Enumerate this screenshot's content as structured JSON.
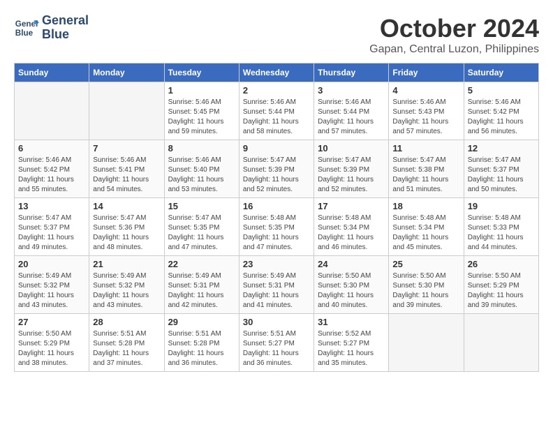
{
  "logo": {
    "line1": "General",
    "line2": "Blue"
  },
  "title": {
    "month_year": "October 2024",
    "location": "Gapan, Central Luzon, Philippines"
  },
  "days_of_week": [
    "Sunday",
    "Monday",
    "Tuesday",
    "Wednesday",
    "Thursday",
    "Friday",
    "Saturday"
  ],
  "weeks": [
    [
      {
        "day": "",
        "sunrise": "",
        "sunset": "",
        "daylight": ""
      },
      {
        "day": "",
        "sunrise": "",
        "sunset": "",
        "daylight": ""
      },
      {
        "day": "1",
        "sunrise": "Sunrise: 5:46 AM",
        "sunset": "Sunset: 5:45 PM",
        "daylight": "Daylight: 11 hours and 59 minutes."
      },
      {
        "day": "2",
        "sunrise": "Sunrise: 5:46 AM",
        "sunset": "Sunset: 5:44 PM",
        "daylight": "Daylight: 11 hours and 58 minutes."
      },
      {
        "day": "3",
        "sunrise": "Sunrise: 5:46 AM",
        "sunset": "Sunset: 5:44 PM",
        "daylight": "Daylight: 11 hours and 57 minutes."
      },
      {
        "day": "4",
        "sunrise": "Sunrise: 5:46 AM",
        "sunset": "Sunset: 5:43 PM",
        "daylight": "Daylight: 11 hours and 57 minutes."
      },
      {
        "day": "5",
        "sunrise": "Sunrise: 5:46 AM",
        "sunset": "Sunset: 5:42 PM",
        "daylight": "Daylight: 11 hours and 56 minutes."
      }
    ],
    [
      {
        "day": "6",
        "sunrise": "Sunrise: 5:46 AM",
        "sunset": "Sunset: 5:42 PM",
        "daylight": "Daylight: 11 hours and 55 minutes."
      },
      {
        "day": "7",
        "sunrise": "Sunrise: 5:46 AM",
        "sunset": "Sunset: 5:41 PM",
        "daylight": "Daylight: 11 hours and 54 minutes."
      },
      {
        "day": "8",
        "sunrise": "Sunrise: 5:46 AM",
        "sunset": "Sunset: 5:40 PM",
        "daylight": "Daylight: 11 hours and 53 minutes."
      },
      {
        "day": "9",
        "sunrise": "Sunrise: 5:47 AM",
        "sunset": "Sunset: 5:39 PM",
        "daylight": "Daylight: 11 hours and 52 minutes."
      },
      {
        "day": "10",
        "sunrise": "Sunrise: 5:47 AM",
        "sunset": "Sunset: 5:39 PM",
        "daylight": "Daylight: 11 hours and 52 minutes."
      },
      {
        "day": "11",
        "sunrise": "Sunrise: 5:47 AM",
        "sunset": "Sunset: 5:38 PM",
        "daylight": "Daylight: 11 hours and 51 minutes."
      },
      {
        "day": "12",
        "sunrise": "Sunrise: 5:47 AM",
        "sunset": "Sunset: 5:37 PM",
        "daylight": "Daylight: 11 hours and 50 minutes."
      }
    ],
    [
      {
        "day": "13",
        "sunrise": "Sunrise: 5:47 AM",
        "sunset": "Sunset: 5:37 PM",
        "daylight": "Daylight: 11 hours and 49 minutes."
      },
      {
        "day": "14",
        "sunrise": "Sunrise: 5:47 AM",
        "sunset": "Sunset: 5:36 PM",
        "daylight": "Daylight: 11 hours and 48 minutes."
      },
      {
        "day": "15",
        "sunrise": "Sunrise: 5:47 AM",
        "sunset": "Sunset: 5:35 PM",
        "daylight": "Daylight: 11 hours and 47 minutes."
      },
      {
        "day": "16",
        "sunrise": "Sunrise: 5:48 AM",
        "sunset": "Sunset: 5:35 PM",
        "daylight": "Daylight: 11 hours and 47 minutes."
      },
      {
        "day": "17",
        "sunrise": "Sunrise: 5:48 AM",
        "sunset": "Sunset: 5:34 PM",
        "daylight": "Daylight: 11 hours and 46 minutes."
      },
      {
        "day": "18",
        "sunrise": "Sunrise: 5:48 AM",
        "sunset": "Sunset: 5:34 PM",
        "daylight": "Daylight: 11 hours and 45 minutes."
      },
      {
        "day": "19",
        "sunrise": "Sunrise: 5:48 AM",
        "sunset": "Sunset: 5:33 PM",
        "daylight": "Daylight: 11 hours and 44 minutes."
      }
    ],
    [
      {
        "day": "20",
        "sunrise": "Sunrise: 5:49 AM",
        "sunset": "Sunset: 5:32 PM",
        "daylight": "Daylight: 11 hours and 43 minutes."
      },
      {
        "day": "21",
        "sunrise": "Sunrise: 5:49 AM",
        "sunset": "Sunset: 5:32 PM",
        "daylight": "Daylight: 11 hours and 43 minutes."
      },
      {
        "day": "22",
        "sunrise": "Sunrise: 5:49 AM",
        "sunset": "Sunset: 5:31 PM",
        "daylight": "Daylight: 11 hours and 42 minutes."
      },
      {
        "day": "23",
        "sunrise": "Sunrise: 5:49 AM",
        "sunset": "Sunset: 5:31 PM",
        "daylight": "Daylight: 11 hours and 41 minutes."
      },
      {
        "day": "24",
        "sunrise": "Sunrise: 5:50 AM",
        "sunset": "Sunset: 5:30 PM",
        "daylight": "Daylight: 11 hours and 40 minutes."
      },
      {
        "day": "25",
        "sunrise": "Sunrise: 5:50 AM",
        "sunset": "Sunset: 5:30 PM",
        "daylight": "Daylight: 11 hours and 39 minutes."
      },
      {
        "day": "26",
        "sunrise": "Sunrise: 5:50 AM",
        "sunset": "Sunset: 5:29 PM",
        "daylight": "Daylight: 11 hours and 39 minutes."
      }
    ],
    [
      {
        "day": "27",
        "sunrise": "Sunrise: 5:50 AM",
        "sunset": "Sunset: 5:29 PM",
        "daylight": "Daylight: 11 hours and 38 minutes."
      },
      {
        "day": "28",
        "sunrise": "Sunrise: 5:51 AM",
        "sunset": "Sunset: 5:28 PM",
        "daylight": "Daylight: 11 hours and 37 minutes."
      },
      {
        "day": "29",
        "sunrise": "Sunrise: 5:51 AM",
        "sunset": "Sunset: 5:28 PM",
        "daylight": "Daylight: 11 hours and 36 minutes."
      },
      {
        "day": "30",
        "sunrise": "Sunrise: 5:51 AM",
        "sunset": "Sunset: 5:27 PM",
        "daylight": "Daylight: 11 hours and 36 minutes."
      },
      {
        "day": "31",
        "sunrise": "Sunrise: 5:52 AM",
        "sunset": "Sunset: 5:27 PM",
        "daylight": "Daylight: 11 hours and 35 minutes."
      },
      {
        "day": "",
        "sunrise": "",
        "sunset": "",
        "daylight": ""
      },
      {
        "day": "",
        "sunrise": "",
        "sunset": "",
        "daylight": ""
      }
    ]
  ]
}
